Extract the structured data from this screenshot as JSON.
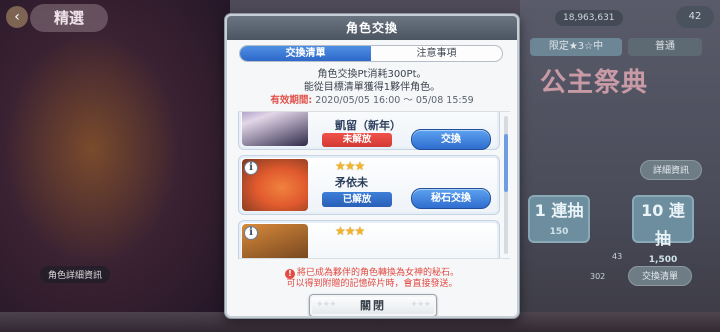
{
  "background": {
    "logo": "精選",
    "stat_main": "18,963,631",
    "count_badge": "42",
    "tabs": [
      "限定★3☆中",
      "普通"
    ],
    "banner_title": "公主祭典",
    "detail_button": "詳細資訊",
    "detail_button_2": "詳細資訊",
    "card_1": {
      "main": "1 連抽",
      "sub": "150"
    },
    "card_10": {
      "main": "10 連抽",
      "sub": "1,500"
    },
    "exchange_button": "交換清單",
    "chip_label": "角色詳細資訊",
    "small_numbers": [
      "43",
      "302"
    ]
  },
  "dialog": {
    "title": "角色交換",
    "tabs": {
      "exchange_list": "交換清單",
      "notes": "注意事項"
    },
    "description_line1": "角色交換Pt消耗300Pt。",
    "description_line2": "能從目標清單獲得1夥伴角色。",
    "period_label": "有效期間:",
    "period_value": "2020/05/05 16:00 ～ 05/08 15:59",
    "rows": [
      {
        "name": "凱留（新年）",
        "stars": "",
        "status": "未解放",
        "action": "交換"
      },
      {
        "name": "矛依未",
        "stars": "★★★",
        "status": "已解放",
        "action": "秘石交換"
      },
      {
        "name": "",
        "stars": "★★★",
        "status": "",
        "action": ""
      }
    ],
    "notice_line1": "將已成為夥伴的角色轉換為女神的秘石。",
    "notice_line2": "可以得到附贈的記憶碎片時，會直接發送。",
    "close_label": "關閉"
  },
  "colors": {
    "accent_blue": "#2f68c9",
    "status_locked": "#d23a34",
    "period_red": "#e0524a"
  }
}
